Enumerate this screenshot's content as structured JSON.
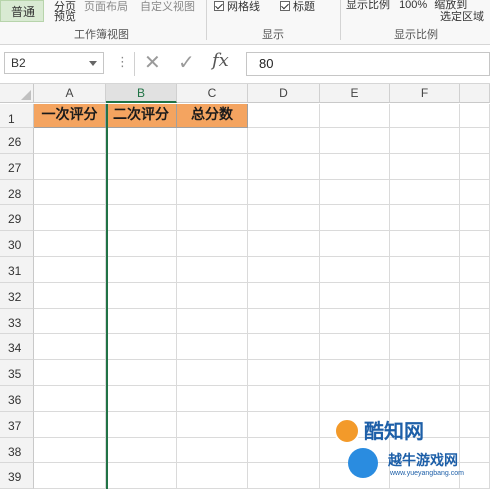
{
  "ribbon": {
    "left_button": "普通",
    "page_layout": "分页",
    "page_layout_2": "预览",
    "page_layout_full": "页面布局",
    "custom_view": "自定义视图",
    "group_workbook_views": "工作簿视图",
    "gridlines": "网格线",
    "headings": "标题",
    "group_show": "显示",
    "zoom_label": "显示比例",
    "zoom_value": "100%",
    "zoom_to_selection_1": "缩放到",
    "zoom_to_selection_2": "选定区域",
    "group_zoom": "显示比例"
  },
  "formula_bar": {
    "name_box": "B2",
    "dots": "⋮",
    "cancel_glyph": "✕",
    "enter_glyph": "✓",
    "fx": "fx",
    "value": "80"
  },
  "sheet": {
    "columns": [
      "A",
      "B",
      "C",
      "D",
      "E",
      "F"
    ],
    "selected_column": "B",
    "header_row_number": "1",
    "header_cells": [
      "一次评分",
      "二次评分",
      "总分数"
    ],
    "header_fill": "#f4a460",
    "rows": [
      "26",
      "27",
      "28",
      "29",
      "30",
      "31",
      "32",
      "33",
      "34",
      "35",
      "36",
      "37",
      "38",
      "39"
    ]
  },
  "watermark": {
    "text_1": "酷知网",
    "text_2": "越牛游戏网",
    "url": "www.yueyangbang.com"
  },
  "colors": {
    "accent_green": "#217346"
  }
}
